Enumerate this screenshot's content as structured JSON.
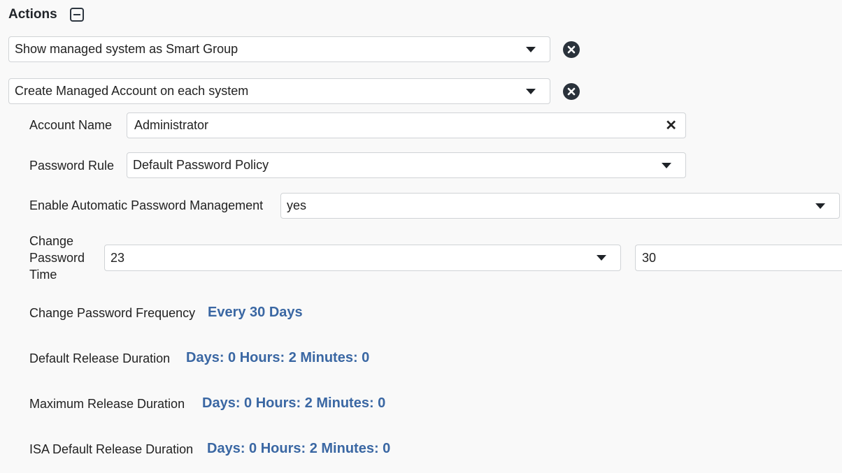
{
  "actions": {
    "title": "Actions",
    "collapse_icon": "minus-square-icon"
  },
  "action_rows": [
    {
      "value": "Show managed system as Smart Group",
      "remove_icon": "close-circle-icon"
    },
    {
      "value": "Create Managed Account on each system",
      "remove_icon": "close-circle-icon"
    }
  ],
  "account_name": {
    "label": "Account Name",
    "value": "Administrator"
  },
  "password_rule": {
    "label": "Password Rule",
    "value": "Default Password Policy"
  },
  "auto_password": {
    "label": "Enable Automatic Password Management",
    "value": "yes"
  },
  "change_time": {
    "label": "Change Password Time",
    "hour": "23",
    "minute": "30"
  },
  "frequency": {
    "label": "Change Password Frequency",
    "value": "Every 30 Days"
  },
  "default_release": {
    "label": "Default Release Duration",
    "value": "Days: 0 Hours: 2 Minutes: 0"
  },
  "max_release": {
    "label": "Maximum Release Duration",
    "value": "Days: 0 Hours: 2 Minutes: 0"
  },
  "isa_release": {
    "label": "ISA Default Release Duration",
    "value": "Days: 0 Hours: 2 Minutes: 0"
  },
  "colors": {
    "link": "#3a67a3",
    "icon_dark": "#2a323b",
    "background": "#f9f9f9"
  }
}
